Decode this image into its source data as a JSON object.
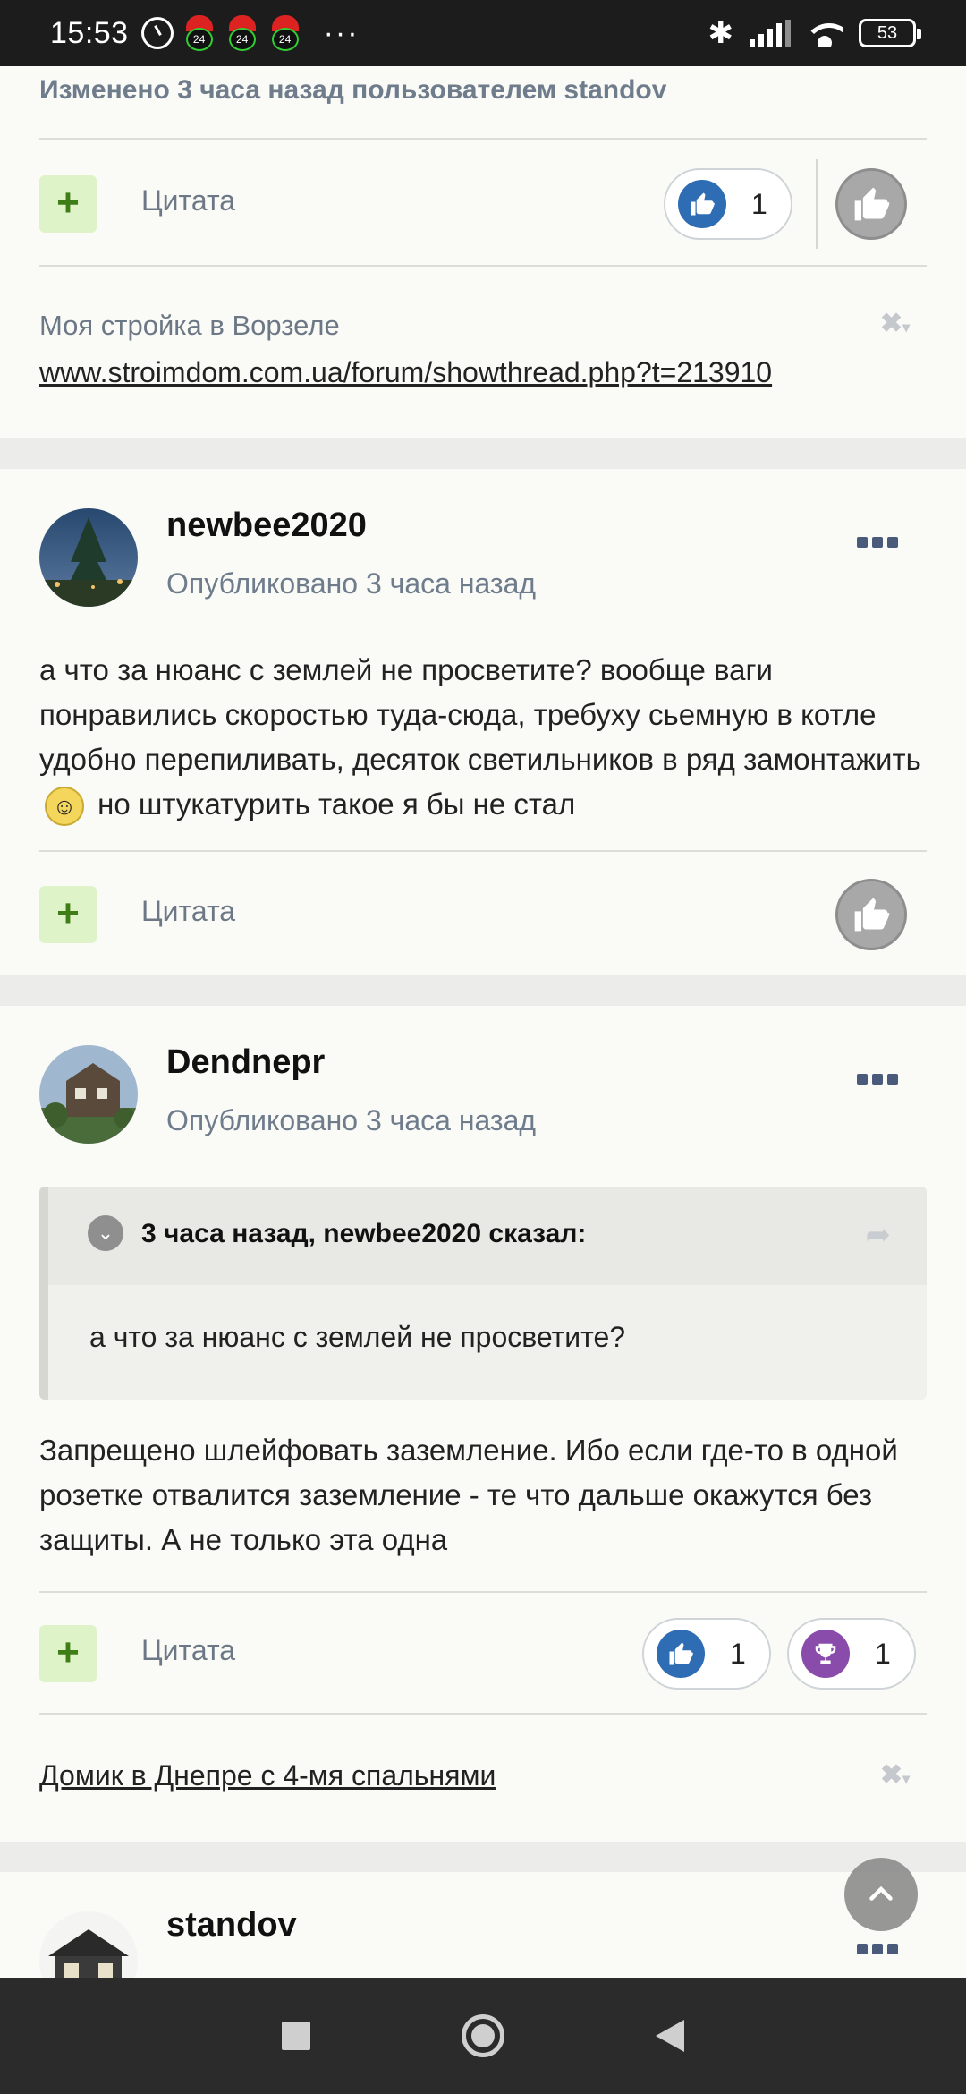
{
  "status_bar": {
    "time": "15:53",
    "santa_badges": [
      "24",
      "24",
      "24"
    ],
    "overflow": "···",
    "battery": "53"
  },
  "post1": {
    "edited_note": "Изменено 3 часа назад пользователем standov",
    "quote_label": "Цитата",
    "like_count": "1",
    "signature_label": "Моя стройка в Ворзеле",
    "signature_link": "www.stroimdom.com.ua/forum/showthread.php?t=213910"
  },
  "post2": {
    "author": "newbee2020",
    "posted": "Опубликовано 3 часа назад",
    "text_before_emoji": "а что за нюанс с землей не просветите? вообще ваги понравились скоростью туда-сюда, требуху сьемную в котле удобно перепиливать, десяток светильников в ряд замонтажить",
    "text_after_emoji": "но штукатурить такое я бы не стал",
    "quote_label": "Цитата"
  },
  "post3": {
    "author": "Dendnepr",
    "posted": "Опубликовано 3 часа назад",
    "quote_title": "3 часа назад, newbee2020 сказал:",
    "quote_text": "а что за нюанс с землей не просветите?",
    "text": "Запрещено шлейфовать заземление. Ибо если где-то в одной розетке отвалится заземление - те что дальше окажутся без защиты. А не только эта одна",
    "quote_label": "Цитата",
    "like_count": "1",
    "trophy_count": "1",
    "signature_link": "Домик в Днепре с 4-мя спальнями"
  },
  "post4": {
    "author": "standov"
  },
  "colors": {
    "accent_green": "#3f7d17",
    "like_blue": "#2e6db4",
    "trophy_purple": "#8a4cab",
    "muted_text": "#6e7c8c"
  }
}
